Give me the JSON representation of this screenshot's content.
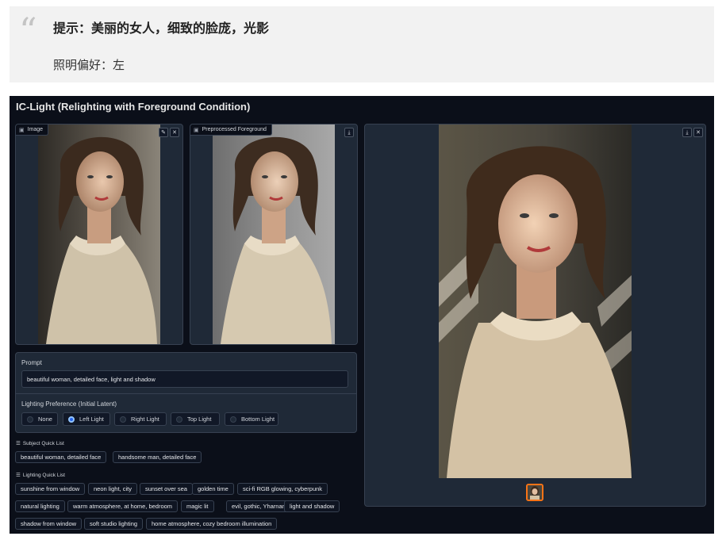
{
  "quote": {
    "mark": "“",
    "line1": "提示：美丽的女人，细致的脸庞，光影",
    "line2": "照明偏好：左"
  },
  "app": {
    "title": "IC-Light (Relighting with Foreground Condition)",
    "image_panel": {
      "label": "Image",
      "edit_icon": "✎",
      "close_icon": "✕"
    },
    "preprocessed_panel": {
      "label": "Preprocessed Foreground",
      "download_icon": "⤓"
    },
    "output_panel": {
      "download_icon": "⤓",
      "close_icon": "✕"
    },
    "prompt": {
      "label": "Prompt",
      "value": "beautiful woman, detailed face, light and shadow"
    },
    "lighting": {
      "label": "Lighting Preference (Initial Latent)",
      "options": [
        "None",
        "Left Light",
        "Right Light",
        "Top Light",
        "Bottom Light"
      ],
      "selected": "Left Light"
    },
    "subject_quick_list": {
      "label": "Subject Quick List",
      "items": [
        "beautiful woman, detailed face",
        "handsome man, detailed face"
      ]
    },
    "lighting_quick_list": {
      "label": "Lighting Quick List",
      "items": [
        "sunshine from window",
        "neon light, city",
        "sunset over sea",
        "golden time",
        "sci-fi RGB glowing, cyberpunk",
        "natural lighting",
        "warm atmosphere, at home, bedroom",
        "magic lit",
        "evil, gothic, Yharnam",
        "light and shadow",
        "shadow from window",
        "soft studio lighting",
        "home atmosphere, cozy bedroom illumination"
      ]
    }
  }
}
